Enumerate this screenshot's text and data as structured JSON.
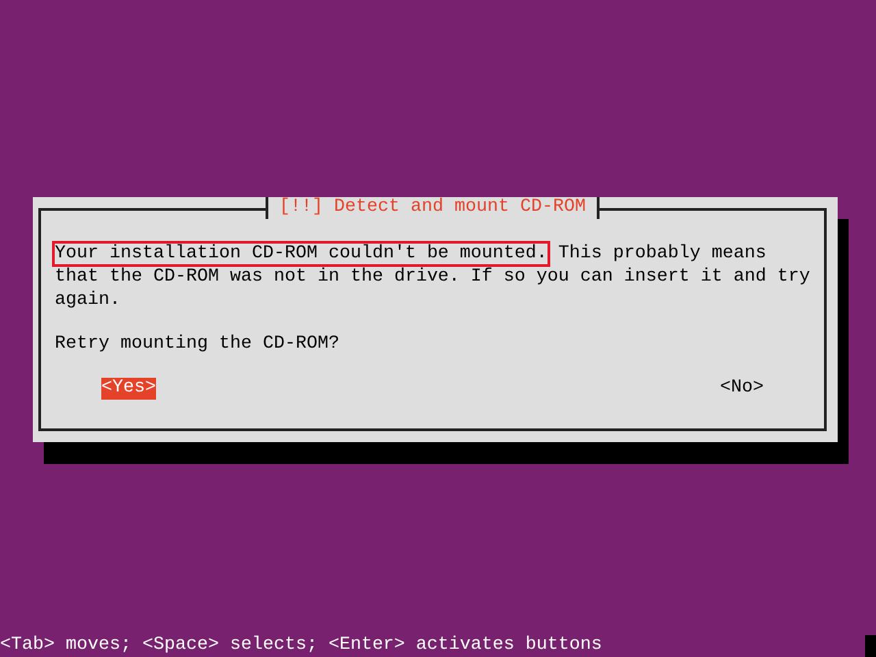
{
  "dialog": {
    "title": "[!!] Detect and mount CD-ROM",
    "message": {
      "highlighted": "Your installation CD-ROM couldn't be mounted.",
      "rest": "This probably means that the CD-ROM was not in the drive. If so you can insert it and try again."
    },
    "question": "Retry mounting the CD-ROM?",
    "buttons": [
      {
        "label": "<Yes>",
        "selected": true
      },
      {
        "label": "<No>",
        "selected": false
      }
    ]
  },
  "status_bar": "<Tab> moves; <Space> selects; <Enter> activates buttons"
}
